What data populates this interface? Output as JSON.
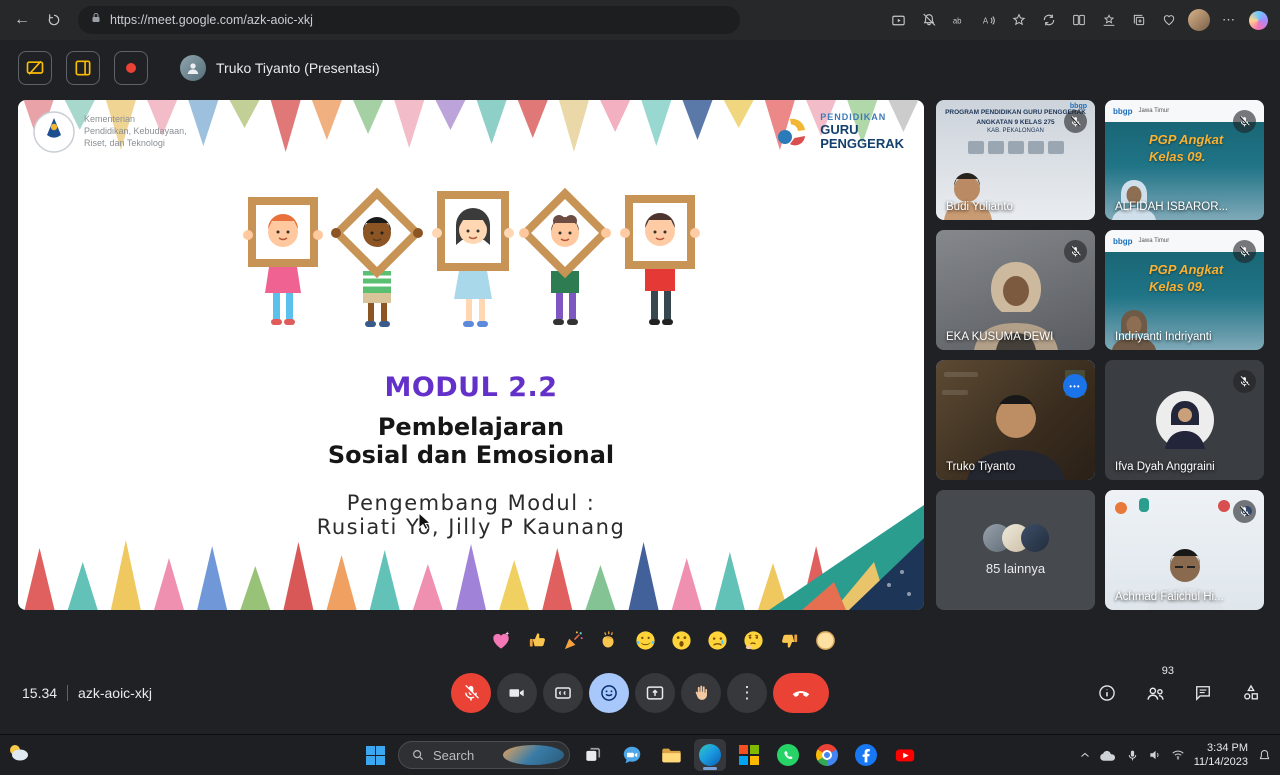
{
  "browser": {
    "url": "https://meet.google.com/azk-aoic-xkj"
  },
  "meet": {
    "presenter_label": "Truko Tiyanto (Presentasi)",
    "clock": "15.34",
    "meeting_code": "azk-aoic-xkj",
    "people_count": "93"
  },
  "slide": {
    "ministry_lines": [
      "Kementerian",
      "Pendidikan, Kebudayaan,",
      "Riset, dan Teknologi"
    ],
    "program_lines": [
      "PENDIDIKAN",
      "GURU",
      "PENGGERAK"
    ],
    "module": "MODUL 2.2",
    "title_line1": "Pembelajaran",
    "title_line2": "Sosial dan Emosional",
    "subtitle_line1": "Pengembang Modul :",
    "subtitle_line2": "Rusiati Yo, Jilly P Kaunang",
    "colors": {
      "module": "#6330c9",
      "pencils_top": [
        "#e8a2a8",
        "#a8d8cc",
        "#f0d494",
        "#f2bcc8",
        "#9cc0de",
        "#c2cf96",
        "#e07878",
        "#f0b080",
        "#a4d0a4",
        "#f2bcc8",
        "#bca4da",
        "#8ed0c8",
        "#e07878",
        "#ead8a8",
        "#f2b0c0",
        "#98d8d0",
        "#5a78a8",
        "#f0d67e",
        "#ec8888",
        "#f2bcc8",
        "#b0d8a8",
        "#cccccc"
      ],
      "pencils_bottom": [
        "#e06060",
        "#62c2b8",
        "#f0c860",
        "#f090b0",
        "#7098d8",
        "#98c278",
        "#d85858",
        "#f0a060",
        "#62c2b8",
        "#f090b0",
        "#a082d8",
        "#f0d060",
        "#e06060",
        "#84c494",
        "#42609a",
        "#f090b0",
        "#62c2b8",
        "#f0c860",
        "#e06060",
        "#7098d8",
        "#98c278"
      ]
    }
  },
  "participants": [
    {
      "name": "Budi Yulianto",
      "variant": "budi",
      "muted": true,
      "corner_logo": "bbgp",
      "slide_lines": [
        "PROGRAM PENDIDIKAN GURU PENGGERAK",
        "ANGKATAN 9 KELAS 275",
        "KAB. PEKALONGAN"
      ]
    },
    {
      "name": "ALFIDAH ISBAROR...",
      "variant": "pgp",
      "muted": true,
      "hijab": "#cfe0ec",
      "slide_lines": [
        "bbgp",
        "Jawa Timur",
        "PGP Angkat",
        "Kelas 09."
      ]
    },
    {
      "name": "EKA KUSUMA DEWI",
      "variant": "person",
      "muted": true
    },
    {
      "name": "Indriyanti Indriyanti",
      "variant": "pgp",
      "muted": true,
      "hijab": "#6e5a46",
      "slide_lines": [
        "bbgp",
        "Jawa Timur",
        "PGP Angkat",
        "Kelas 09."
      ]
    },
    {
      "name": "Truko Tiyanto",
      "variant": "room",
      "active": true,
      "menu": true
    },
    {
      "name": "Ifva Dyah Anggraini",
      "variant": "avatar",
      "muted": true
    },
    {
      "name": "85 lainnya",
      "variant": "overflow"
    },
    {
      "name": "Achmad Falichul Hi...",
      "variant": "achmad",
      "muted": true
    }
  ],
  "reactions": [
    {
      "icon": "sparkling-heart"
    },
    {
      "icon": "thumbs-up"
    },
    {
      "icon": "party-popper"
    },
    {
      "icon": "clapping-hands"
    },
    {
      "icon": "face-joy"
    },
    {
      "icon": "face-wow"
    },
    {
      "icon": "face-sad"
    },
    {
      "icon": "face-thinking"
    },
    {
      "icon": "thumbs-down"
    },
    {
      "icon": "skin-tone"
    }
  ],
  "taskbar": {
    "search_label": "Search",
    "time": "3:34 PM",
    "date": "11/14/2023"
  }
}
